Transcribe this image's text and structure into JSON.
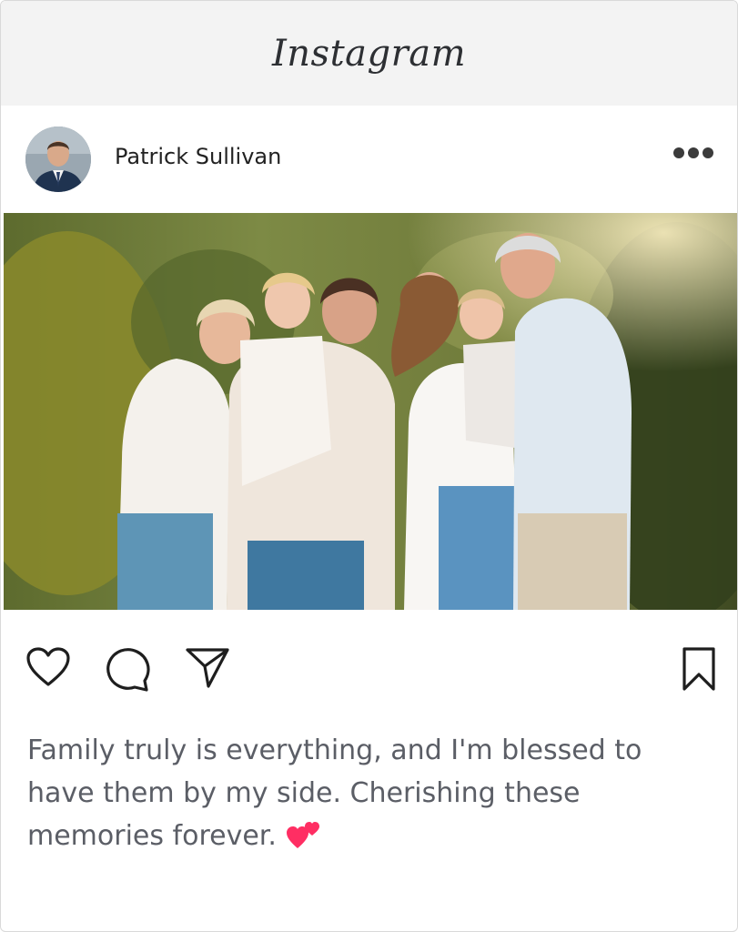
{
  "app": {
    "title": "Instagram"
  },
  "post": {
    "author": "Patrick Sullivan",
    "caption": "Family truly is everything, and I'm blessed to have them by my side. Cherishing these memories forever.",
    "caption_emoji": "two-hearts-icon"
  },
  "colors": {
    "header_bg": "#f3f3f3",
    "text_dark": "#222222",
    "caption_text": "#5b5e66",
    "heart_accent": "#ff2e63",
    "icon_stroke": "#1e1e1e"
  },
  "icons": [
    "more-options-icon",
    "like-heart-icon",
    "comment-icon",
    "share-icon",
    "bookmark-icon"
  ]
}
